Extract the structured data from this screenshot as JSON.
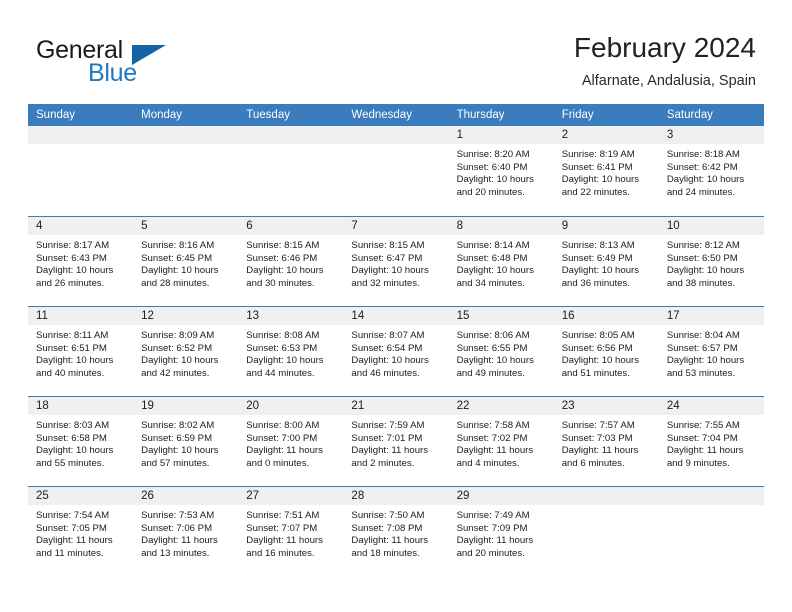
{
  "brand": {
    "word_one": "General",
    "word_two": "Blue",
    "logo_icon": "triangle-logo-icon",
    "accent_color": "#1f7ac4",
    "header_color": "#3a7cbd"
  },
  "header": {
    "title": "February 2024",
    "location": "Alfarnate, Andalusia, Spain"
  },
  "calendar": {
    "weekdays": [
      "Sunday",
      "Monday",
      "Tuesday",
      "Wednesday",
      "Thursday",
      "Friday",
      "Saturday"
    ],
    "weeks": [
      [
        {
          "day": "",
          "sunrise": "",
          "sunset": "",
          "daylight_a": "",
          "daylight_b": ""
        },
        {
          "day": "",
          "sunrise": "",
          "sunset": "",
          "daylight_a": "",
          "daylight_b": ""
        },
        {
          "day": "",
          "sunrise": "",
          "sunset": "",
          "daylight_a": "",
          "daylight_b": ""
        },
        {
          "day": "",
          "sunrise": "",
          "sunset": "",
          "daylight_a": "",
          "daylight_b": ""
        },
        {
          "day": "1",
          "sunrise": "Sunrise: 8:20 AM",
          "sunset": "Sunset: 6:40 PM",
          "daylight_a": "Daylight: 10 hours",
          "daylight_b": "and 20 minutes."
        },
        {
          "day": "2",
          "sunrise": "Sunrise: 8:19 AM",
          "sunset": "Sunset: 6:41 PM",
          "daylight_a": "Daylight: 10 hours",
          "daylight_b": "and 22 minutes."
        },
        {
          "day": "3",
          "sunrise": "Sunrise: 8:18 AM",
          "sunset": "Sunset: 6:42 PM",
          "daylight_a": "Daylight: 10 hours",
          "daylight_b": "and 24 minutes."
        }
      ],
      [
        {
          "day": "4",
          "sunrise": "Sunrise: 8:17 AM",
          "sunset": "Sunset: 6:43 PM",
          "daylight_a": "Daylight: 10 hours",
          "daylight_b": "and 26 minutes."
        },
        {
          "day": "5",
          "sunrise": "Sunrise: 8:16 AM",
          "sunset": "Sunset: 6:45 PM",
          "daylight_a": "Daylight: 10 hours",
          "daylight_b": "and 28 minutes."
        },
        {
          "day": "6",
          "sunrise": "Sunrise: 8:15 AM",
          "sunset": "Sunset: 6:46 PM",
          "daylight_a": "Daylight: 10 hours",
          "daylight_b": "and 30 minutes."
        },
        {
          "day": "7",
          "sunrise": "Sunrise: 8:15 AM",
          "sunset": "Sunset: 6:47 PM",
          "daylight_a": "Daylight: 10 hours",
          "daylight_b": "and 32 minutes."
        },
        {
          "day": "8",
          "sunrise": "Sunrise: 8:14 AM",
          "sunset": "Sunset: 6:48 PM",
          "daylight_a": "Daylight: 10 hours",
          "daylight_b": "and 34 minutes."
        },
        {
          "day": "9",
          "sunrise": "Sunrise: 8:13 AM",
          "sunset": "Sunset: 6:49 PM",
          "daylight_a": "Daylight: 10 hours",
          "daylight_b": "and 36 minutes."
        },
        {
          "day": "10",
          "sunrise": "Sunrise: 8:12 AM",
          "sunset": "Sunset: 6:50 PM",
          "daylight_a": "Daylight: 10 hours",
          "daylight_b": "and 38 minutes."
        }
      ],
      [
        {
          "day": "11",
          "sunrise": "Sunrise: 8:11 AM",
          "sunset": "Sunset: 6:51 PM",
          "daylight_a": "Daylight: 10 hours",
          "daylight_b": "and 40 minutes."
        },
        {
          "day": "12",
          "sunrise": "Sunrise: 8:09 AM",
          "sunset": "Sunset: 6:52 PM",
          "daylight_a": "Daylight: 10 hours",
          "daylight_b": "and 42 minutes."
        },
        {
          "day": "13",
          "sunrise": "Sunrise: 8:08 AM",
          "sunset": "Sunset: 6:53 PM",
          "daylight_a": "Daylight: 10 hours",
          "daylight_b": "and 44 minutes."
        },
        {
          "day": "14",
          "sunrise": "Sunrise: 8:07 AM",
          "sunset": "Sunset: 6:54 PM",
          "daylight_a": "Daylight: 10 hours",
          "daylight_b": "and 46 minutes."
        },
        {
          "day": "15",
          "sunrise": "Sunrise: 8:06 AM",
          "sunset": "Sunset: 6:55 PM",
          "daylight_a": "Daylight: 10 hours",
          "daylight_b": "and 49 minutes."
        },
        {
          "day": "16",
          "sunrise": "Sunrise: 8:05 AM",
          "sunset": "Sunset: 6:56 PM",
          "daylight_a": "Daylight: 10 hours",
          "daylight_b": "and 51 minutes."
        },
        {
          "day": "17",
          "sunrise": "Sunrise: 8:04 AM",
          "sunset": "Sunset: 6:57 PM",
          "daylight_a": "Daylight: 10 hours",
          "daylight_b": "and 53 minutes."
        }
      ],
      [
        {
          "day": "18",
          "sunrise": "Sunrise: 8:03 AM",
          "sunset": "Sunset: 6:58 PM",
          "daylight_a": "Daylight: 10 hours",
          "daylight_b": "and 55 minutes."
        },
        {
          "day": "19",
          "sunrise": "Sunrise: 8:02 AM",
          "sunset": "Sunset: 6:59 PM",
          "daylight_a": "Daylight: 10 hours",
          "daylight_b": "and 57 minutes."
        },
        {
          "day": "20",
          "sunrise": "Sunrise: 8:00 AM",
          "sunset": "Sunset: 7:00 PM",
          "daylight_a": "Daylight: 11 hours",
          "daylight_b": "and 0 minutes."
        },
        {
          "day": "21",
          "sunrise": "Sunrise: 7:59 AM",
          "sunset": "Sunset: 7:01 PM",
          "daylight_a": "Daylight: 11 hours",
          "daylight_b": "and 2 minutes."
        },
        {
          "day": "22",
          "sunrise": "Sunrise: 7:58 AM",
          "sunset": "Sunset: 7:02 PM",
          "daylight_a": "Daylight: 11 hours",
          "daylight_b": "and 4 minutes."
        },
        {
          "day": "23",
          "sunrise": "Sunrise: 7:57 AM",
          "sunset": "Sunset: 7:03 PM",
          "daylight_a": "Daylight: 11 hours",
          "daylight_b": "and 6 minutes."
        },
        {
          "day": "24",
          "sunrise": "Sunrise: 7:55 AM",
          "sunset": "Sunset: 7:04 PM",
          "daylight_a": "Daylight: 11 hours",
          "daylight_b": "and 9 minutes."
        }
      ],
      [
        {
          "day": "25",
          "sunrise": "Sunrise: 7:54 AM",
          "sunset": "Sunset: 7:05 PM",
          "daylight_a": "Daylight: 11 hours",
          "daylight_b": "and 11 minutes."
        },
        {
          "day": "26",
          "sunrise": "Sunrise: 7:53 AM",
          "sunset": "Sunset: 7:06 PM",
          "daylight_a": "Daylight: 11 hours",
          "daylight_b": "and 13 minutes."
        },
        {
          "day": "27",
          "sunrise": "Sunrise: 7:51 AM",
          "sunset": "Sunset: 7:07 PM",
          "daylight_a": "Daylight: 11 hours",
          "daylight_b": "and 16 minutes."
        },
        {
          "day": "28",
          "sunrise": "Sunrise: 7:50 AM",
          "sunset": "Sunset: 7:08 PM",
          "daylight_a": "Daylight: 11 hours",
          "daylight_b": "and 18 minutes."
        },
        {
          "day": "29",
          "sunrise": "Sunrise: 7:49 AM",
          "sunset": "Sunset: 7:09 PM",
          "daylight_a": "Daylight: 11 hours",
          "daylight_b": "and 20 minutes."
        },
        {
          "day": "",
          "sunrise": "",
          "sunset": "",
          "daylight_a": "",
          "daylight_b": ""
        },
        {
          "day": "",
          "sunrise": "",
          "sunset": "",
          "daylight_a": "",
          "daylight_b": ""
        }
      ]
    ]
  }
}
